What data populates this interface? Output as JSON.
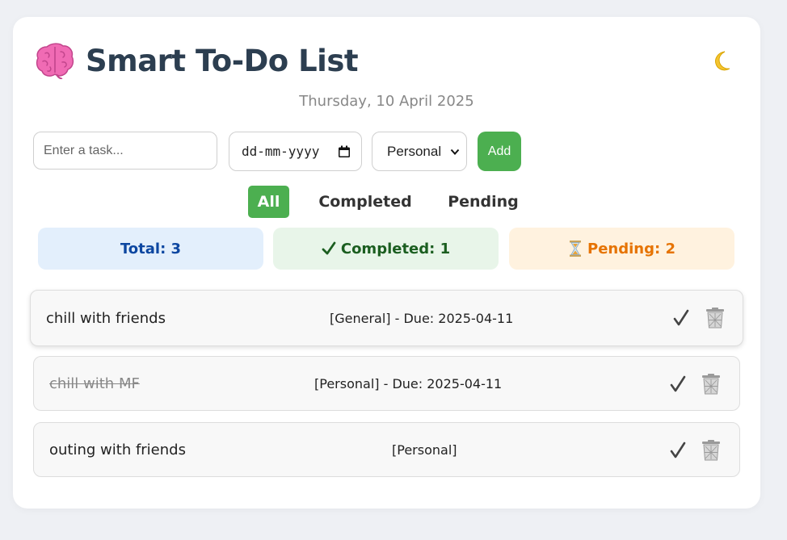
{
  "app": {
    "title": "Smart To-Do List",
    "brain_icon": "brain-icon",
    "theme_icon": "crescent-moon-icon"
  },
  "date_display": "Thursday, 10 April 2025",
  "form": {
    "task_placeholder": "Enter a task...",
    "date_placeholder": "dd-mm-yyyy",
    "category_selected": "Personal",
    "add_label": "Add"
  },
  "filters": [
    {
      "label": "All",
      "active": true
    },
    {
      "label": "Completed",
      "active": false
    },
    {
      "label": "Pending",
      "active": false
    }
  ],
  "stats": {
    "total": "Total: 3",
    "completed": "Completed: 1",
    "pending": "Pending: 2"
  },
  "tasks": [
    {
      "name": "chill with friends",
      "meta": "[General] - Due: 2025-04-11",
      "completed": false
    },
    {
      "name": "chill with MF",
      "meta": "[Personal] - Due: 2025-04-11",
      "completed": true
    },
    {
      "name": "outing with friends",
      "meta": "[Personal]",
      "completed": false
    }
  ],
  "colors": {
    "accent": "#4caf50",
    "title": "#2c3e50",
    "total_bg": "#e3effc",
    "total_fg": "#0d47a1",
    "completed_bg": "#e8f5e9",
    "completed_fg": "#1b5e20",
    "pending_bg": "#fff2df",
    "pending_fg": "#e67300"
  }
}
